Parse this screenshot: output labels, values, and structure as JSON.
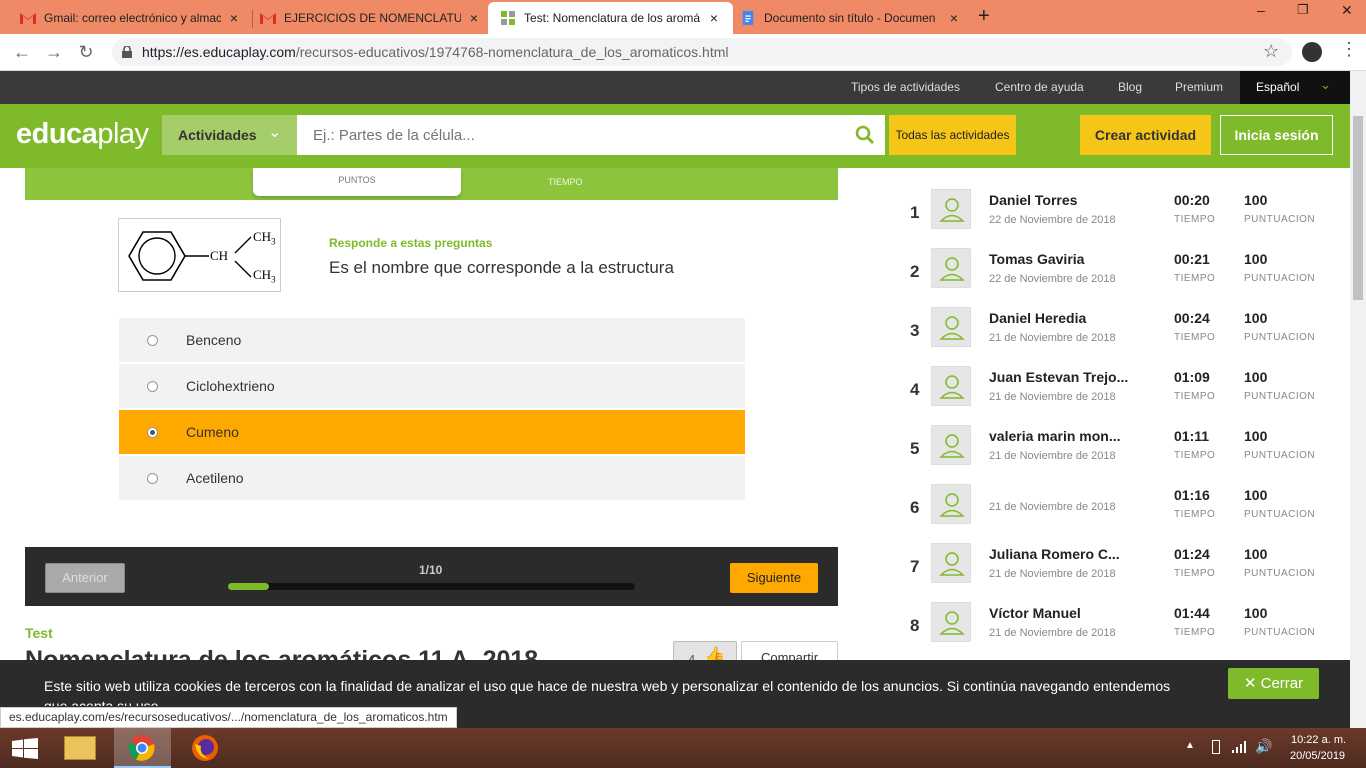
{
  "browser": {
    "tabs": [
      {
        "title": "Gmail: correo electrónico y almac",
        "close": "×"
      },
      {
        "title": "EJERCICIOS DE NOMENCLATURA",
        "close": "×"
      },
      {
        "title": "Test: Nomenclatura de los aromá",
        "close": "×"
      },
      {
        "title": "Documento sin título - Documen",
        "close": "×"
      }
    ],
    "new_tab": "+",
    "url_host": "https://es.educaplay.com",
    "url_path": "/recursos-educativos/1974768-nomenclatura_de_los_aromaticos.html",
    "window_controls": [
      "–",
      "❐",
      "✕"
    ]
  },
  "site": {
    "top_links": [
      "Tipos de actividades",
      "Centro de ayuda",
      "Blog",
      "Premium"
    ],
    "language": "Español",
    "logo_left": "educa",
    "logo_right": "play",
    "category_button": "Actividades",
    "search_placeholder": "Ej.: Partes de la célula...",
    "all_activities": "Todas las actividades",
    "create_button": "Crear actividad",
    "login_button": "Inicia sesión"
  },
  "quiz": {
    "points_label": "PUNTOS",
    "time_label": "TIEMPO",
    "structure": {
      "ch": "CH",
      "ch3_top": "CH",
      "ch3_bottom": "CH",
      "sub": "3"
    },
    "prompt_label": "Responde a estas preguntas",
    "question": "Es el nombre que corresponde a la estructura",
    "options": [
      {
        "label": "Benceno",
        "selected": false
      },
      {
        "label": "Ciclohextrieno",
        "selected": false
      },
      {
        "label": "Cumeno",
        "selected": true
      },
      {
        "label": "Acetileno",
        "selected": false
      }
    ],
    "prev_button": "Anterior",
    "next_button": "Siguiente",
    "progress_text": "1/10",
    "progress": 0.1,
    "activity_type": "Test",
    "activity_title": "Nomenclatura de los aromáticos 11 A, 2018",
    "likes": "4",
    "share_button": "Compartir"
  },
  "leaderboard": [
    {
      "rank": "1",
      "name": "Daniel Torres",
      "date": "22 de Noviembre de 2018",
      "time": "00:20",
      "score": "100"
    },
    {
      "rank": "2",
      "name": "Tomas Gaviria",
      "date": "22 de Noviembre de 2018",
      "time": "00:21",
      "score": "100"
    },
    {
      "rank": "3",
      "name": "Daniel Heredia",
      "date": "21 de Noviembre de 2018",
      "time": "00:24",
      "score": "100"
    },
    {
      "rank": "4",
      "name": "Juan Estevan Trejo...",
      "date": "21 de Noviembre de 2018",
      "time": "01:09",
      "score": "100"
    },
    {
      "rank": "5",
      "name": "valeria marin mon...",
      "date": "21 de Noviembre de 2018",
      "time": "01:11",
      "score": "100"
    },
    {
      "rank": "6",
      "name": "",
      "date": "21 de Noviembre de 2018",
      "time": "01:16",
      "score": "100"
    },
    {
      "rank": "7",
      "name": "Juliana Romero C...",
      "date": "21 de Noviembre de 2018",
      "time": "01:24",
      "score": "100"
    },
    {
      "rank": "8",
      "name": "Víctor Manuel",
      "date": "21 de Noviembre de 2018",
      "time": "01:44",
      "score": "100"
    }
  ],
  "leaderboard_labels": {
    "time": "TIEMPO",
    "score": "PUNTUACION"
  },
  "cookie": {
    "text": "Este sitio web utiliza cookies de terceros con la finalidad de analizar el uso que hace de nuestra web y personalizar el contenido de los anuncios. Si continúa navegando entendemos que acepta su uso.",
    "close_button": "Cerrar"
  },
  "status_url": "es.educaplay.com/es/recursoseducativos/.../nomenclatura_de_los_aromaticos.htm",
  "taskbar": {
    "time": "10:22 a. m.",
    "date": "20/05/2019"
  },
  "colors": {
    "green": "#7fba2a",
    "orange": "#ffa800",
    "yellow": "#f5c518",
    "dark": "#2b2b2b"
  }
}
